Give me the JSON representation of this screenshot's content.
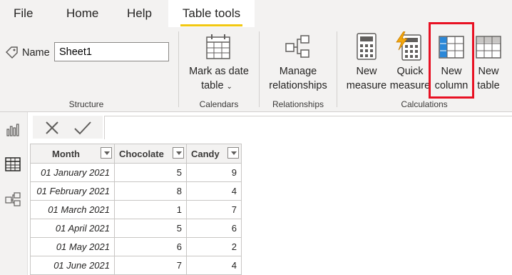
{
  "ribbon": {
    "tabs": [
      {
        "label": "File"
      },
      {
        "label": "Home"
      },
      {
        "label": "Help"
      },
      {
        "label": "Table tools"
      }
    ],
    "structure": {
      "name_label": "Name",
      "name_value": "Sheet1",
      "group_label": "Structure"
    },
    "calendars": {
      "button_line1": "Mark as date",
      "button_line2": "table",
      "group_label": "Calendars"
    },
    "relationships": {
      "button_line1": "Manage",
      "button_line2": "relationships",
      "group_label": "Relationships"
    },
    "calculations": {
      "new_measure_line1": "New",
      "new_measure_line2": "measure",
      "quick_measure_line1": "Quick",
      "quick_measure_line2": "measure",
      "new_column_line1": "New",
      "new_column_line2": "column",
      "new_table_line1": "New",
      "new_table_line2": "table",
      "group_label": "Calculations"
    }
  },
  "table": {
    "columns": [
      "Month",
      "Chocolate",
      "Candy"
    ],
    "rows": [
      [
        "01 January 2021",
        "5",
        "9"
      ],
      [
        "01 February 2021",
        "8",
        "4"
      ],
      [
        "01 March 2021",
        "1",
        "7"
      ],
      [
        "01 April 2021",
        "5",
        "6"
      ],
      [
        "01 May 2021",
        "6",
        "2"
      ],
      [
        "01 June 2021",
        "7",
        "4"
      ]
    ]
  },
  "colors": {
    "accent": "#f2c811",
    "highlight": "#e81123"
  }
}
